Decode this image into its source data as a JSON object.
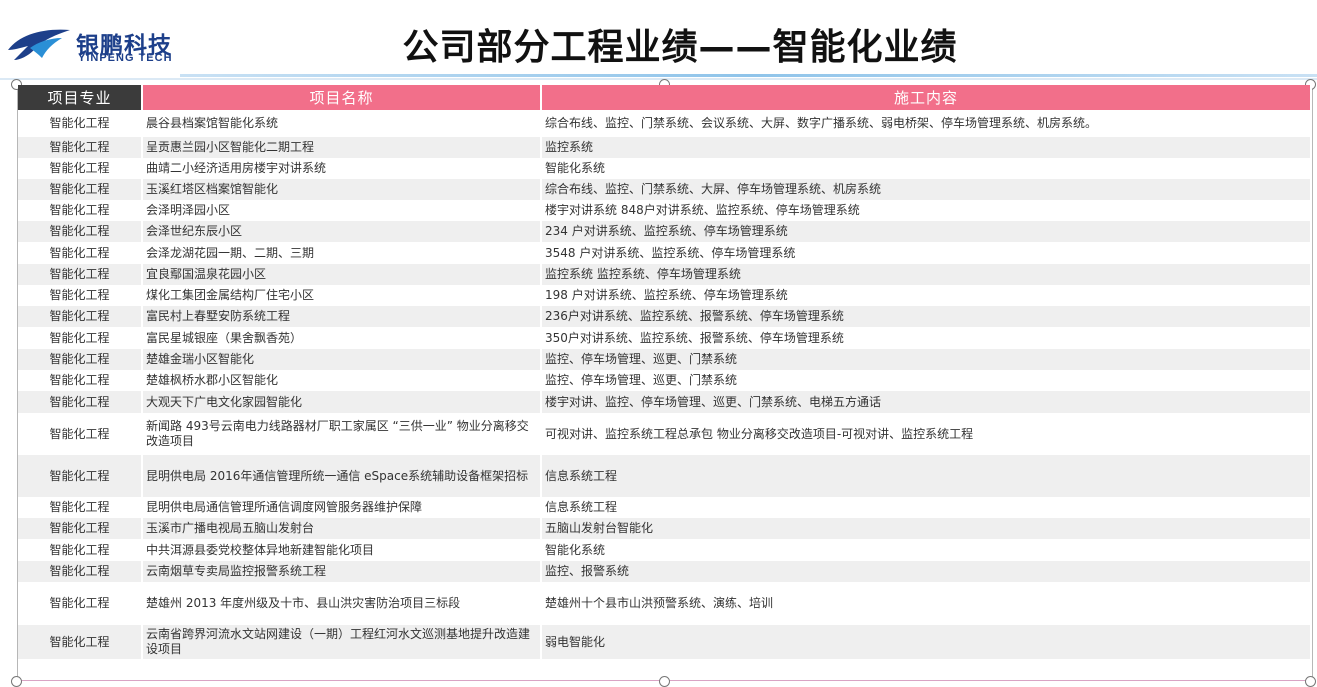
{
  "header": {
    "logo_cn": "银鹏科技",
    "logo_en": "YINPENG TECH",
    "title": "公司部分工程业绩——智能化业绩"
  },
  "table": {
    "columns": [
      "项目专业",
      "项目名称",
      "施工内容"
    ],
    "rows": [
      {
        "type": "智能化工程",
        "name": "晨谷县档案馆智能化系统",
        "content": "综合布线、监控、门禁系统、会议系统、大屏、数字广播系统、弱电桥架、停车场管理系统、机房系统。"
      },
      {
        "type": "智能化工程",
        "name": "呈贡惠兰园小区智能化二期工程",
        "content": "监控系统"
      },
      {
        "type": "智能化工程",
        "name": "曲靖二小经济适用房楼宇对讲系统",
        "content": "智能化系统"
      },
      {
        "type": "智能化工程",
        "name": "玉溪红塔区档案馆智能化",
        "content": "综合布线、监控、门禁系统、大屏、停车场管理系统、机房系统"
      },
      {
        "type": "智能化工程",
        "name": "会泽明泽园小区",
        "content": "楼宇对讲系统 848户对讲系统、监控系统、停车场管理系统"
      },
      {
        "type": "智能化工程",
        "name": "会泽世纪东辰小区",
        "content": "234 户对讲系统、监控系统、停车场管理系统"
      },
      {
        "type": "智能化工程",
        "name": "会泽龙湖花园一期、二期、三期",
        "content": "3548 户对讲系统、监控系统、停车场管理系统"
      },
      {
        "type": "智能化工程",
        "name": "宜良鄢国温泉花园小区",
        "content": "监控系统 监控系统、停车场管理系统"
      },
      {
        "type": "智能化工程",
        "name": "煤化工集团金属结构厂住宅小区",
        "content": "198 户对讲系统、监控系统、停车场管理系统"
      },
      {
        "type": "智能化工程",
        "name": "富民村上春墅安防系统工程",
        "content": "236户对讲系统、监控系统、报警系统、停车场管理系统"
      },
      {
        "type": "智能化工程",
        "name": "富民星城银座（果舍飘香苑）",
        "content": "350户对讲系统、监控系统、报警系统、停车场管理系统"
      },
      {
        "type": "智能化工程",
        "name": "楚雄金瑞小区智能化",
        "content": "监控、停车场管理、巡更、门禁系统"
      },
      {
        "type": "智能化工程",
        "name": "楚雄枫桥水郡小区智能化",
        "content": "监控、停车场管理、巡更、门禁系统"
      },
      {
        "type": "智能化工程",
        "name": "大观天下广电文化家园智能化",
        "content": "楼宇对讲、监控、停车场管理、巡更、门禁系统、电梯五方通话"
      },
      {
        "type": "智能化工程",
        "name": "新闻路 493号云南电力线路器材厂职工家属区 “三供一业” 物业分离移交改造项目",
        "content": "可视对讲、监控系统工程总承包 物业分离移交改造项目-可视对讲、监控系统工程"
      },
      {
        "type": "智能化工程",
        "name": "昆明供电局 2016年通信管理所统一通信 eSpace系统辅助设备框架招标",
        "content": "信息系统工程"
      },
      {
        "type": "智能化工程",
        "name": "昆明供电局通信管理所通信调度网管服务器维护保障",
        "content": "信息系统工程"
      },
      {
        "type": "智能化工程",
        "name": "玉溪市广播电视局五脑山发射台",
        "content": "五脑山发射台智能化"
      },
      {
        "type": "智能化工程",
        "name": "中共洱源县委党校整体异地新建智能化项目",
        "content": "智能化系统"
      },
      {
        "type": "智能化工程",
        "name": "云南烟草专卖局监控报警系统工程",
        "content": "监控、报警系统"
      },
      {
        "type": "智能化工程",
        "name": "楚雄州 2013 年度州级及十市、县山洪灾害防治项目三标段",
        "content": "楚雄州十个县市山洪预警系统、演练、培训"
      },
      {
        "type": "智能化工程",
        "name": "云南省跨界河流水文站网建设（一期）工程红河水文巡测基地提升改造建设项目",
        "content": "弱电智能化"
      }
    ]
  }
}
